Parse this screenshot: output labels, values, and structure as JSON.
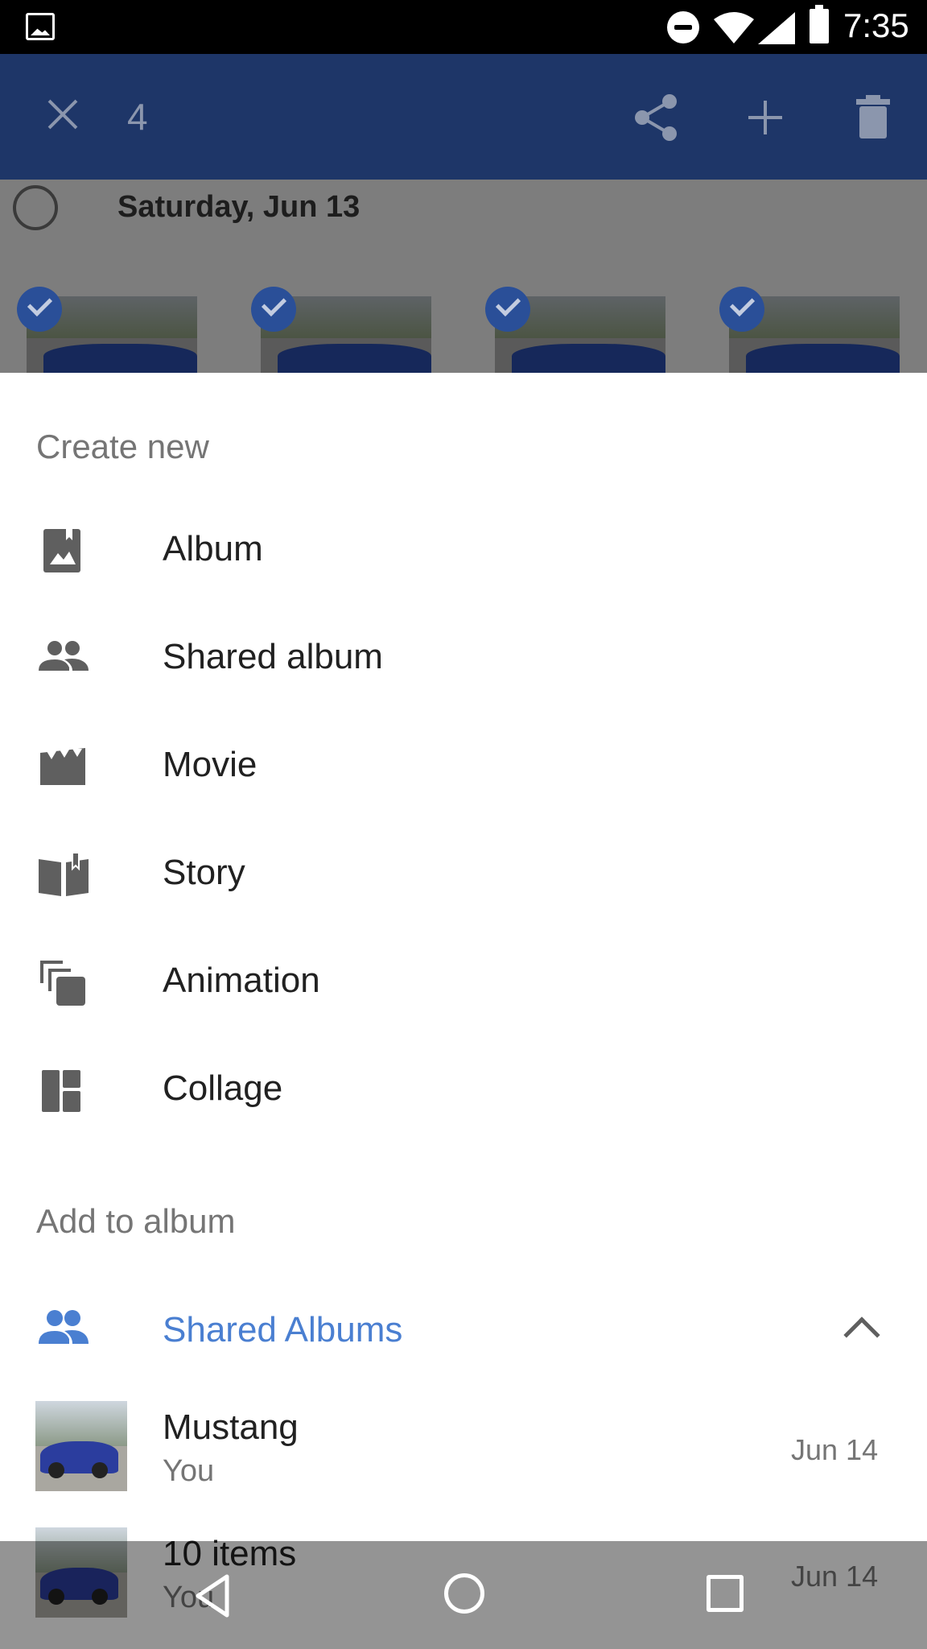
{
  "status_bar": {
    "time": "7:35",
    "icons": [
      "gallery-icon",
      "do-not-disturb-icon",
      "wifi-icon",
      "signal-icon",
      "battery-icon"
    ]
  },
  "selection_bar": {
    "selected_count": "4",
    "icons": [
      "close-icon",
      "share-icon",
      "add-icon",
      "delete-icon"
    ],
    "background_color": "#1e3668"
  },
  "background_content": {
    "date_label": "Saturday, Jun 13",
    "selected_photos": 4
  },
  "sheet": {
    "create_new_title": "Create new",
    "create_items": [
      {
        "label": "Album",
        "icon": "album-icon"
      },
      {
        "label": "Shared album",
        "icon": "people-icon"
      },
      {
        "label": "Movie",
        "icon": "movie-icon"
      },
      {
        "label": "Story",
        "icon": "book-icon"
      },
      {
        "label": "Animation",
        "icon": "animation-icon"
      },
      {
        "label": "Collage",
        "icon": "collage-icon"
      }
    ],
    "add_to_album_title": "Add to album",
    "shared_albums_label": "Shared Albums",
    "shared_albums_color": "#4a7fd1",
    "albums": [
      {
        "name": "Mustang",
        "owner": "You",
        "date": "Jun 14"
      },
      {
        "name": "10 items",
        "owner": "You",
        "date": "Jun 14"
      }
    ]
  },
  "nav_bar": {
    "icons": [
      "back-icon",
      "home-icon",
      "recents-icon"
    ]
  }
}
